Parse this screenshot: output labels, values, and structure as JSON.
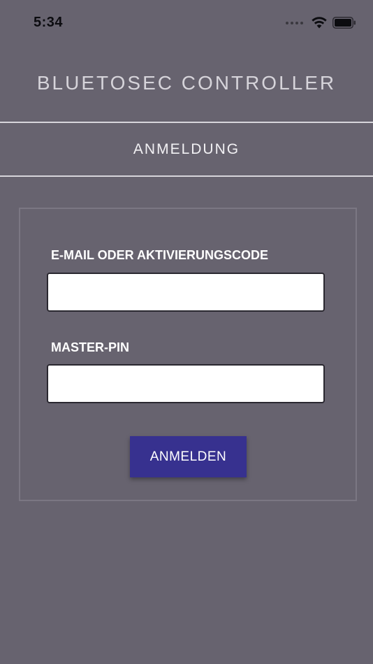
{
  "status_bar": {
    "time": "5:34",
    "icons": [
      "signal-dots-icon",
      "wifi-icon",
      "battery-icon"
    ]
  },
  "header": {
    "app_title": "BLUETOSEC CONTROLLER",
    "section_title": "ANMELDUNG"
  },
  "login_form": {
    "email_label": "E-MAIL ODER AKTIVIERUNGSCODE",
    "email_value": "",
    "pin_label": "MASTER-PIN",
    "pin_value": "",
    "submit_label": "ANMELDEN"
  },
  "colors": {
    "background": "#67636f",
    "button": "#37318f",
    "divider": "#d7d5db"
  }
}
